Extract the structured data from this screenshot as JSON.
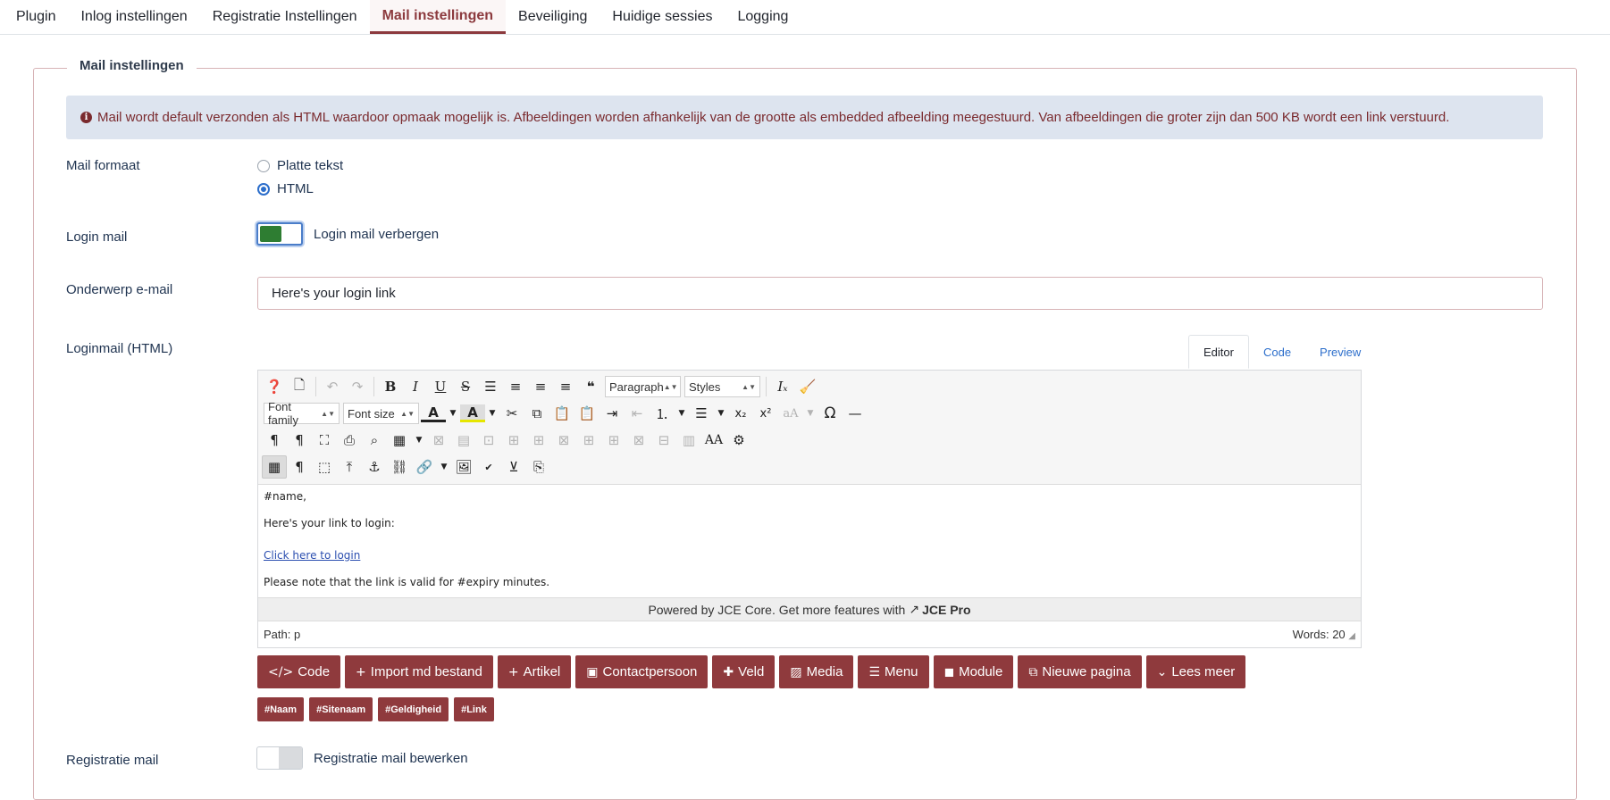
{
  "tabs": [
    "Plugin",
    "Inlog instellingen",
    "Registratie Instellingen",
    "Mail instellingen",
    "Beveiliging",
    "Huidige sessies",
    "Logging"
  ],
  "active_tab": "Mail instellingen",
  "fieldset_legend": "Mail instellingen",
  "alert_text": "Mail wordt default verzonden als HTML waardoor opmaak mogelijk is. Afbeeldingen worden afhankelijk van de grootte als embedded afbeelding meegestuurd. Van afbeeldingen die groter zijn dan 500 KB wordt een link verstuurd.",
  "mail_format": {
    "label": "Mail formaat",
    "options": [
      {
        "label": "Platte tekst",
        "checked": false
      },
      {
        "label": "HTML",
        "checked": true
      }
    ]
  },
  "login_mail": {
    "label": "Login mail",
    "toggle_label": "Login mail verbergen",
    "on": true
  },
  "subject": {
    "label": "Onderwerp e-mail",
    "value": "Here's your login link"
  },
  "loginmail": {
    "label": "Loginmail (HTML)",
    "editor_tabs": [
      "Editor",
      "Code",
      "Preview"
    ],
    "active_editor_tab": "Editor",
    "toolbar": {
      "paragraph": "Paragraph",
      "styles": "Styles",
      "font_family": "Font family",
      "font_size": "Font size"
    },
    "content": {
      "line1": "#name,",
      "line2": "Here's your link to login:",
      "link": "Click here to login",
      "line3": "Please note that the link is valid for #expiry minutes."
    },
    "powered_text": "Powered by JCE Core. Get more features with",
    "powered_brand": "JCE Pro",
    "path_label": "Path:",
    "path_value": "p",
    "words": "Words: 20"
  },
  "buttons": [
    {
      "icon": "</>",
      "label": "Code"
    },
    {
      "icon": "+",
      "label": "Import md bestand"
    },
    {
      "icon": "+",
      "label": "Artikel"
    },
    {
      "icon": "▣",
      "label": "Contactpersoon"
    },
    {
      "icon": "✚",
      "label": "Veld"
    },
    {
      "icon": "▨",
      "label": "Media"
    },
    {
      "icon": "☰",
      "label": "Menu"
    },
    {
      "icon": "◼",
      "label": "Module"
    },
    {
      "icon": "⧉",
      "label": "Nieuwe pagina"
    },
    {
      "icon": "⌄",
      "label": "Lees meer"
    }
  ],
  "tags": [
    "#Naam",
    "#Sitenaam",
    "#Geldigheid",
    "#Link"
  ],
  "registration_mail": {
    "label": "Registratie mail",
    "toggle_label": "Registratie mail bewerken",
    "on": false
  }
}
